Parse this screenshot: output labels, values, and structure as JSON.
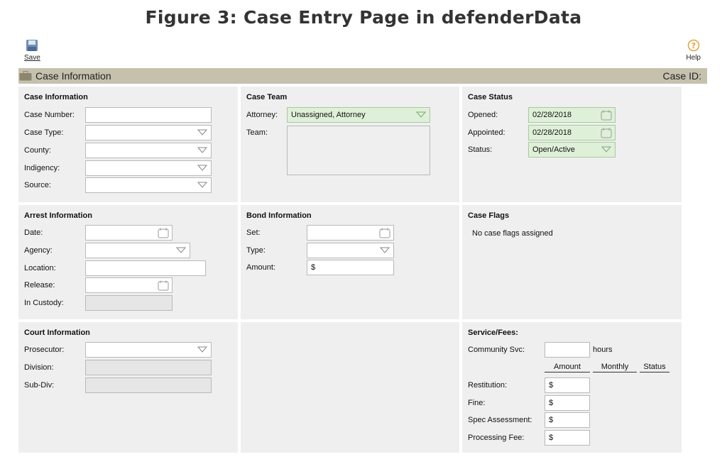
{
  "figure_title": "Figure 3: Case Entry Page in defenderData",
  "toolbar": {
    "save_label": "Save",
    "help_label": "Help"
  },
  "section_bar": {
    "title": "Case Information",
    "case_id_label": "Case ID:"
  },
  "case_information": {
    "heading": "Case Information",
    "case_number_label": "Case Number:",
    "case_number_value": "",
    "case_type_label": "Case Type:",
    "case_type_value": "",
    "county_label": "County:",
    "county_value": "",
    "indigency_label": "Indigency:",
    "indigency_value": "",
    "source_label": "Source:",
    "source_value": ""
  },
  "case_team": {
    "heading": "Case Team",
    "attorney_label": "Attorney:",
    "attorney_value": "Unassigned, Attorney",
    "team_label": "Team:"
  },
  "case_status": {
    "heading": "Case Status",
    "opened_label": "Opened:",
    "opened_value": "02/28/2018",
    "appointed_label": "Appointed:",
    "appointed_value": "02/28/2018",
    "status_label": "Status:",
    "status_value": "Open/Active"
  },
  "arrest_information": {
    "heading": "Arrest Information",
    "date_label": "Date:",
    "date_value": "",
    "agency_label": "Agency:",
    "agency_value": "",
    "location_label": "Location:",
    "location_value": "",
    "release_label": "Release:",
    "release_value": "",
    "in_custody_label": "In Custody:",
    "in_custody_value": ""
  },
  "bond_information": {
    "heading": "Bond Information",
    "set_label": "Set:",
    "set_value": "",
    "type_label": "Type:",
    "type_value": "",
    "amount_label": "Amount:",
    "amount_value": "$"
  },
  "case_flags": {
    "heading": "Case Flags",
    "empty_text": "No case flags assigned"
  },
  "court_information": {
    "heading": "Court Information",
    "prosecutor_label": "Prosecutor:",
    "prosecutor_value": "",
    "division_label": "Division:",
    "division_value": "",
    "subdiv_label": "Sub-Div:",
    "subdiv_value": ""
  },
  "service_fees": {
    "heading": "Service/Fees:",
    "community_svc_label": "Community Svc:",
    "community_svc_value": "",
    "hours_label": "hours",
    "columns": [
      "Amount",
      "Monthly",
      "Status"
    ],
    "restitution_label": "Restitution:",
    "restitution_value": "$",
    "fine_label": "Fine:",
    "fine_value": "$",
    "spec_assessment_label": "Spec Assessment:",
    "spec_assessment_value": "$",
    "processing_fee_label": "Processing Fee:",
    "processing_fee_value": "$"
  },
  "colors": {
    "section_bar": "#c6c1ad",
    "panel_bg": "#efefef",
    "green_field": "#dff0d8",
    "help_accent": "#e6a23c"
  },
  "icons": {
    "save": "floppy-disk-icon",
    "help": "question-circle-icon",
    "section": "briefcase-icon",
    "dropdown": "chevron-down-icon",
    "date": "calendar-icon"
  }
}
